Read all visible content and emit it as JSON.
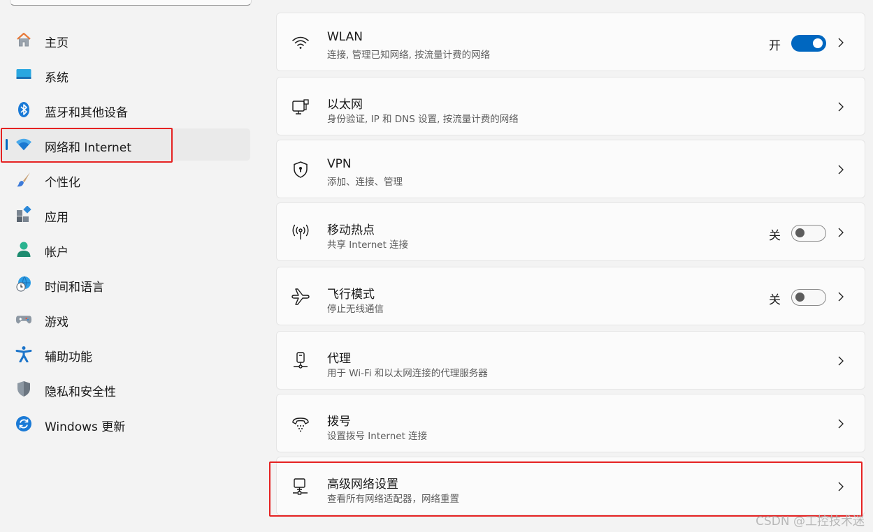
{
  "sidebar": {
    "items": [
      {
        "label": "主页",
        "icon": "home-icon"
      },
      {
        "label": "系统",
        "icon": "display-icon"
      },
      {
        "label": "蓝牙和其他设备",
        "icon": "bluetooth-icon"
      },
      {
        "label": "网络和 Internet",
        "icon": "wifi-icon",
        "selected": true
      },
      {
        "label": "个性化",
        "icon": "brush-icon"
      },
      {
        "label": "应用",
        "icon": "apps-icon"
      },
      {
        "label": "帐户",
        "icon": "person-icon"
      },
      {
        "label": "时间和语言",
        "icon": "globe-clock-icon"
      },
      {
        "label": "游戏",
        "icon": "gamepad-icon"
      },
      {
        "label": "辅助功能",
        "icon": "accessibility-icon"
      },
      {
        "label": "隐私和安全性",
        "icon": "shield-icon"
      },
      {
        "label": "Windows 更新",
        "icon": "update-icon"
      }
    ]
  },
  "main": {
    "cards": [
      {
        "title": "WLAN",
        "subtitle": "连接, 管理已知网络, 按流量计费的网络",
        "icon": "wifi-outline-icon",
        "state": "开",
        "toggle": "on"
      },
      {
        "title": "以太网",
        "subtitle": "身份验证, IP 和 DNS 设置, 按流量计费的网络",
        "icon": "ethernet-icon"
      },
      {
        "title": "VPN",
        "subtitle": "添加、连接、管理",
        "icon": "vpn-shield-icon"
      },
      {
        "title": "移动热点",
        "subtitle": "共享 Internet 连接",
        "icon": "hotspot-icon",
        "state": "关",
        "toggle": "off"
      },
      {
        "title": "飞行模式",
        "subtitle": "停止无线通信",
        "icon": "airplane-icon",
        "state": "关",
        "toggle": "off"
      },
      {
        "title": "代理",
        "subtitle": "用于 Wi-Fi 和以太网连接的代理服务器",
        "icon": "proxy-icon"
      },
      {
        "title": "拨号",
        "subtitle": "设置拨号 Internet 连接",
        "icon": "dialup-icon"
      },
      {
        "title": "高级网络设置",
        "subtitle": "查看所有网络适配器，网络重置",
        "icon": "advanced-network-icon"
      }
    ]
  },
  "colors": {
    "accent": "#0067c0",
    "annotation": "#e52222"
  },
  "watermark": "CSDN @工控技术迷"
}
